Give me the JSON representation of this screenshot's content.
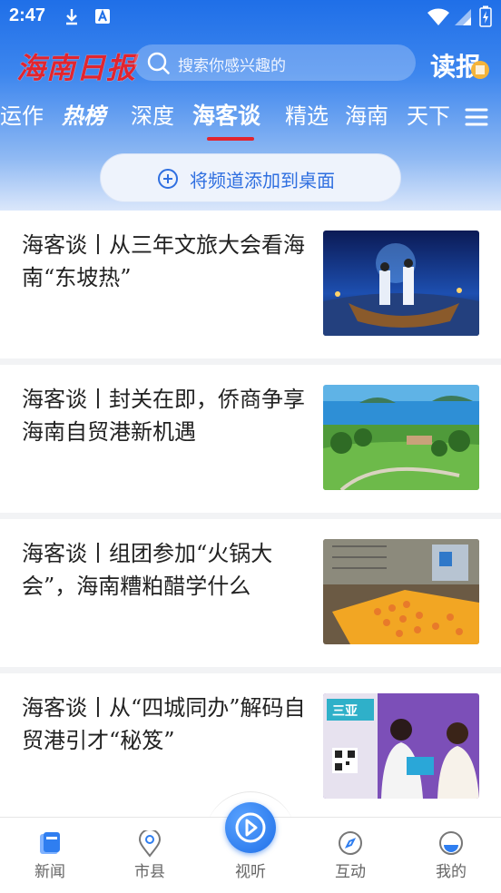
{
  "status_bar": {
    "time": "2:47"
  },
  "header": {
    "logo_text": "海南日报",
    "search_placeholder": "搜索你感兴趣的",
    "read_button_label": "读报"
  },
  "tabs": [
    {
      "label": "运作"
    },
    {
      "label": "热榜"
    },
    {
      "label": "深度"
    },
    {
      "label": "海客谈",
      "active": true
    },
    {
      "label": "精选"
    },
    {
      "label": "海南"
    },
    {
      "label": "天下"
    }
  ],
  "add_channel_label": "将频道添加到桌面",
  "articles": [
    {
      "title": "海客谈丨从三年文旅大会看海南“东坡热”"
    },
    {
      "title": "海客谈丨封关在即，侨商争享海南自贸港新机遇"
    },
    {
      "title": "海客谈丨组团参加“火锅大会”，海南糟粕醋学什么"
    },
    {
      "title": "海客谈丨从“四城同办”解码自贸港引才“秘笈”",
      "thumb_sign": "三亚"
    }
  ],
  "bottom_nav": [
    {
      "label": "新闻",
      "icon": "news-icon"
    },
    {
      "label": "市县",
      "icon": "location-pin-icon"
    },
    {
      "label": "视听",
      "icon": "play-icon"
    },
    {
      "label": "互动",
      "icon": "compass-icon"
    },
    {
      "label": "我的",
      "icon": "profile-icon"
    }
  ],
  "colors": {
    "brand_blue": "#1f6fe8",
    "accent_red": "#e2252f"
  }
}
